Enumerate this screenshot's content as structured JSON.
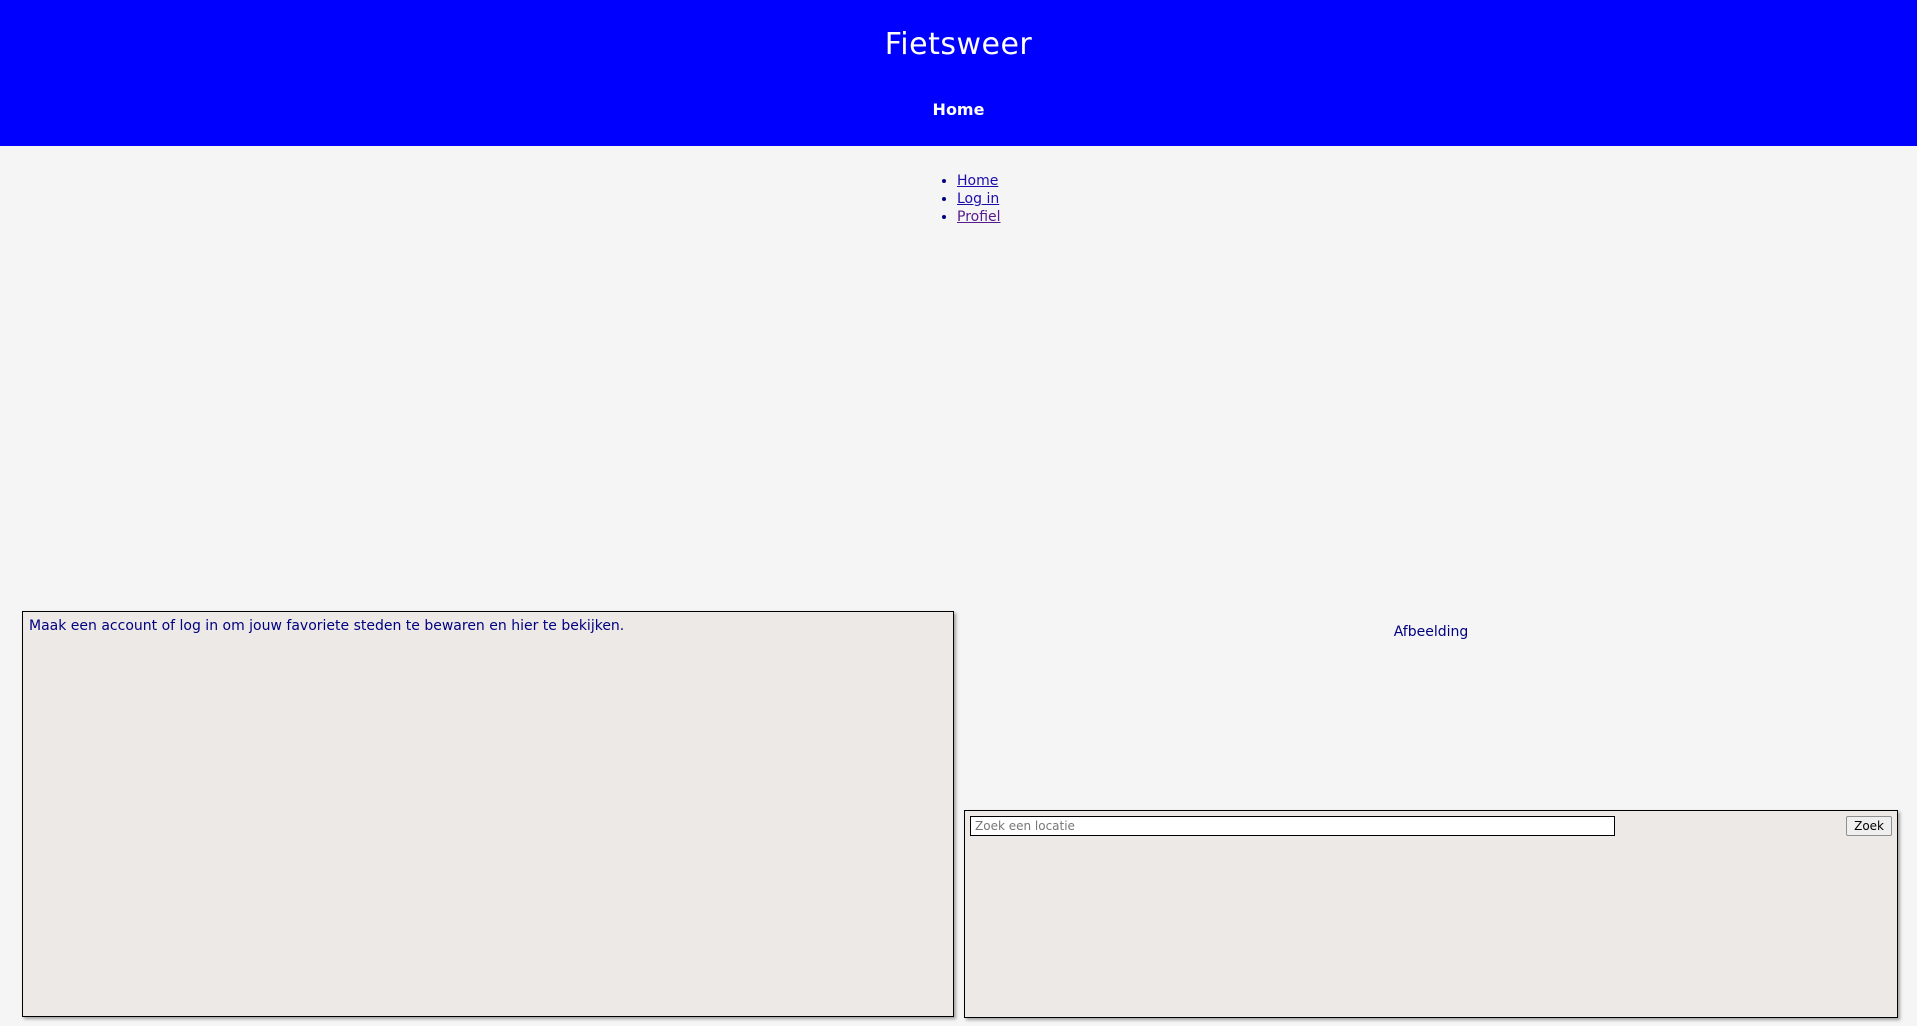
{
  "header": {
    "title": "Fietsweer",
    "nav_label": "Home"
  },
  "nav": {
    "items": [
      {
        "label": "Home"
      },
      {
        "label": "Log in"
      },
      {
        "label": "Profiel"
      }
    ]
  },
  "favorites": {
    "message": "Maak een account of log in om jouw favoriete steden te bewaren en hier te bekijken."
  },
  "image": {
    "alt_text": "Afbeelding"
  },
  "search": {
    "placeholder": "Zoek een locatie",
    "value": "",
    "button_label": "Zoek"
  },
  "colors": {
    "header_bg": "#0000ff",
    "page_bg": "#f5f5f5",
    "panel_bg": "#ede9e6",
    "text": "#000080"
  }
}
